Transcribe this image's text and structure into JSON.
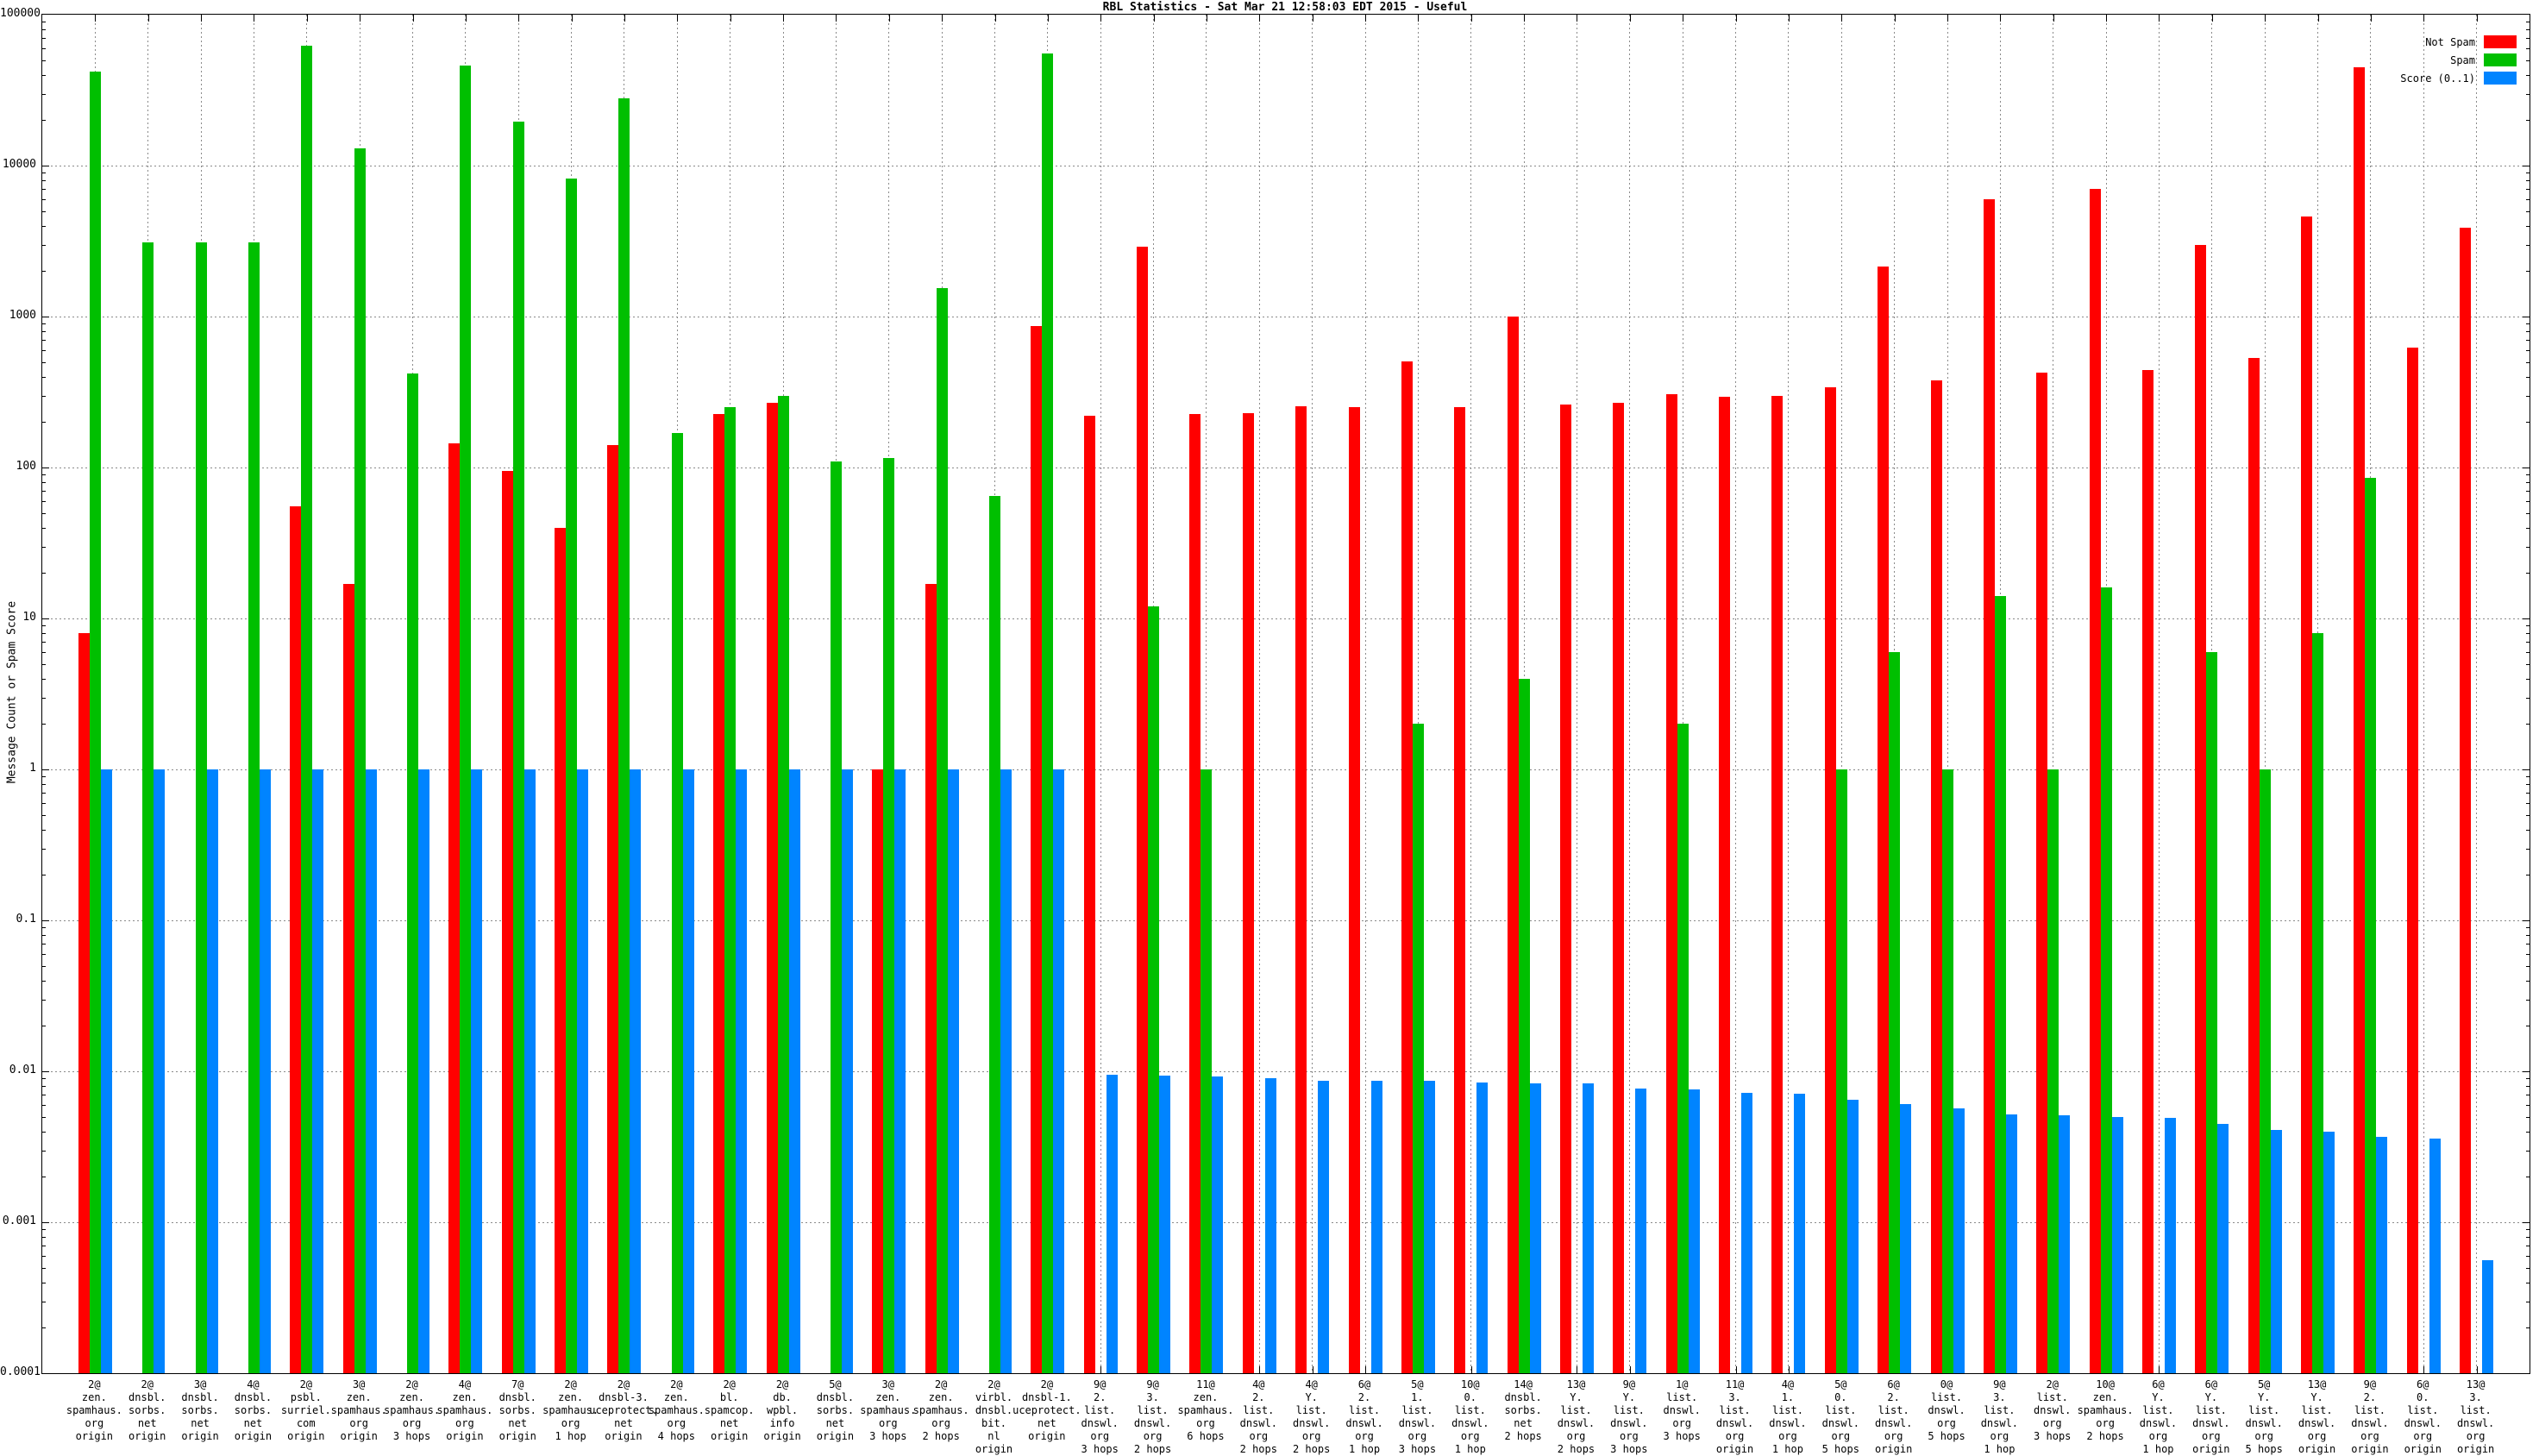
{
  "chart_data": {
    "type": "bar",
    "title": "RBL Statistics - Sat Mar 21 12:58:03 EDT 2015 - Useful",
    "ylabel": "Message Count or Spam Score",
    "xlabel": "",
    "y_scale": "log",
    "ylim": [
      0.0001,
      100000
    ],
    "y_ticks": [
      "100000",
      "10000",
      "1000",
      "100",
      "10",
      "1",
      "0.1",
      "0.01",
      "0.001",
      "0.0001"
    ],
    "grid": true,
    "legend_position": "top-right",
    "legend": [
      {
        "label": "Not Spam",
        "color": "#ff0000"
      },
      {
        "label": "Spam",
        "color": "#00bf00"
      },
      {
        "label": "Score (0..1)",
        "color": "#0084ff"
      }
    ],
    "categories": [
      "2@\nzen.\nspamhaus.\norg\norigin",
      "2@\ndnsbl.\nsorbs.\nnet\norigin",
      "3@\ndnsbl.\nsorbs.\nnet\norigin",
      "4@\ndnsbl.\nsorbs.\nnet\norigin",
      "2@\npsbl.\nsurriel.\ncom\norigin",
      "3@\nzen.\nspamhaus.\norg\norigin",
      "2@\nzen.\nspamhaus.\norg\n3 hops",
      "4@\nzen.\nspamhaus.\norg\norigin",
      "7@\ndnsbl.\nsorbs.\nnet\norigin",
      "2@\nzen.\nspamhaus.\norg\n1 hop",
      "2@\ndnsbl-3.\nuceprotect.\nnet\norigin",
      "2@\nzen.\nspamhaus.\norg\n4 hops",
      "2@\nbl.\nspamcop.\nnet\norigin",
      "2@\ndb.\nwpbl.\ninfo\norigin",
      "5@\ndnsbl.\nsorbs.\nnet\norigin",
      "3@\nzen.\nspamhaus.\norg\n3 hops",
      "2@\nzen.\nspamhaus.\norg\n2 hops",
      "2@\nvirbl.\ndnsbl.\nbit.\nnl\norigin",
      "2@\ndnsbl-1.\nuceprotect.\nnet\norigin",
      "9@\n2.\nlist.\ndnswl.\norg\n3 hops",
      "9@\n3.\nlist.\ndnswl.\norg\n2 hops",
      "11@\nzen.\nspamhaus.\norg\n6 hops",
      "4@\n2.\nlist.\ndnswl.\norg\n2 hops",
      "4@\nY.\nlist.\ndnswl.\norg\n2 hops",
      "6@\n2.\nlist.\ndnswl.\norg\n1 hop",
      "5@\n1.\nlist.\ndnswl.\norg\n3 hops",
      "10@\n0.\nlist.\ndnswl.\norg\n1 hop",
      "14@\ndnsbl.\nsorbs.\nnet\n2 hops",
      "13@\nY.\nlist.\ndnswl.\norg\n2 hops",
      "9@\nY.\nlist.\ndnswl.\norg\n3 hops",
      "1@\nlist.\ndnswl.\norg\n3 hops",
      "11@\n3.\nlist.\ndnswl.\norg\norigin",
      "4@\n1.\nlist.\ndnswl.\norg\n1 hop",
      "5@\n0.\nlist.\ndnswl.\norg\n5 hops",
      "6@\n2.\nlist.\ndnswl.\norg\norigin",
      "0@\nlist.\ndnswl.\norg\n5 hops",
      "9@\n3.\nlist.\ndnswl.\norg\n1 hop",
      "2@\nlist.\ndnswl.\norg\n3 hops",
      "10@\nzen.\nspamhaus.\norg\n2 hops",
      "6@\nY.\nlist.\ndnswl.\norg\n1 hop",
      "6@\nY.\nlist.\ndnswl.\norg\norigin",
      "5@\nY.\nlist.\ndnswl.\norg\n5 hops",
      "13@\nY.\nlist.\ndnswl.\norg\norigin",
      "9@\n2.\nlist.\ndnswl.\norg\norigin",
      "6@\n0.\nlist.\ndnswl.\norg\norigin",
      "13@\n3.\nlist.\ndnswl.\norg\norigin"
    ],
    "series": [
      {
        "name": "Not Spam",
        "color": "#ff0000",
        "values": [
          8,
          0,
          0,
          0,
          55,
          17,
          0,
          145,
          95,
          40,
          140,
          0,
          225,
          270,
          0,
          1,
          17,
          0,
          870,
          220,
          2900,
          225,
          228,
          255,
          250,
          505,
          250,
          1000,
          260,
          268,
          305,
          295,
          300,
          340,
          2150,
          380,
          6000,
          425,
          7000,
          440,
          3000,
          530,
          4600,
          45000,
          620,
          3900
        ]
      },
      {
        "name": "Spam",
        "color": "#00bf00",
        "values": [
          42000,
          3100,
          3100,
          3100,
          62000,
          13000,
          420,
          46000,
          19500,
          8200,
          28000,
          170,
          250,
          300,
          110,
          115,
          1550,
          65,
          55000,
          0,
          12,
          1,
          0,
          0,
          0,
          2,
          0,
          4,
          0,
          0,
          2,
          0,
          0,
          1,
          6,
          1,
          14,
          1,
          16,
          0,
          6,
          1,
          8,
          85,
          0,
          0
        ]
      },
      {
        "name": "Score (0..1)",
        "color": "#0084ff",
        "values": [
          1,
          1,
          1,
          1,
          1,
          1,
          1,
          1,
          1,
          1,
          1,
          1,
          1,
          1,
          1,
          1,
          1,
          1,
          1,
          0.0095,
          0.0094,
          0.0092,
          0.009,
          0.0087,
          0.0086,
          0.0086,
          0.0084,
          0.0083,
          0.0083,
          0.0077,
          0.0076,
          0.0072,
          0.0071,
          0.0065,
          0.0061,
          0.0057,
          0.0052,
          0.0051,
          0.005,
          0.0049,
          0.0045,
          0.0041,
          0.004,
          0.0037,
          0.0036,
          0.00056
        ]
      }
    ]
  }
}
